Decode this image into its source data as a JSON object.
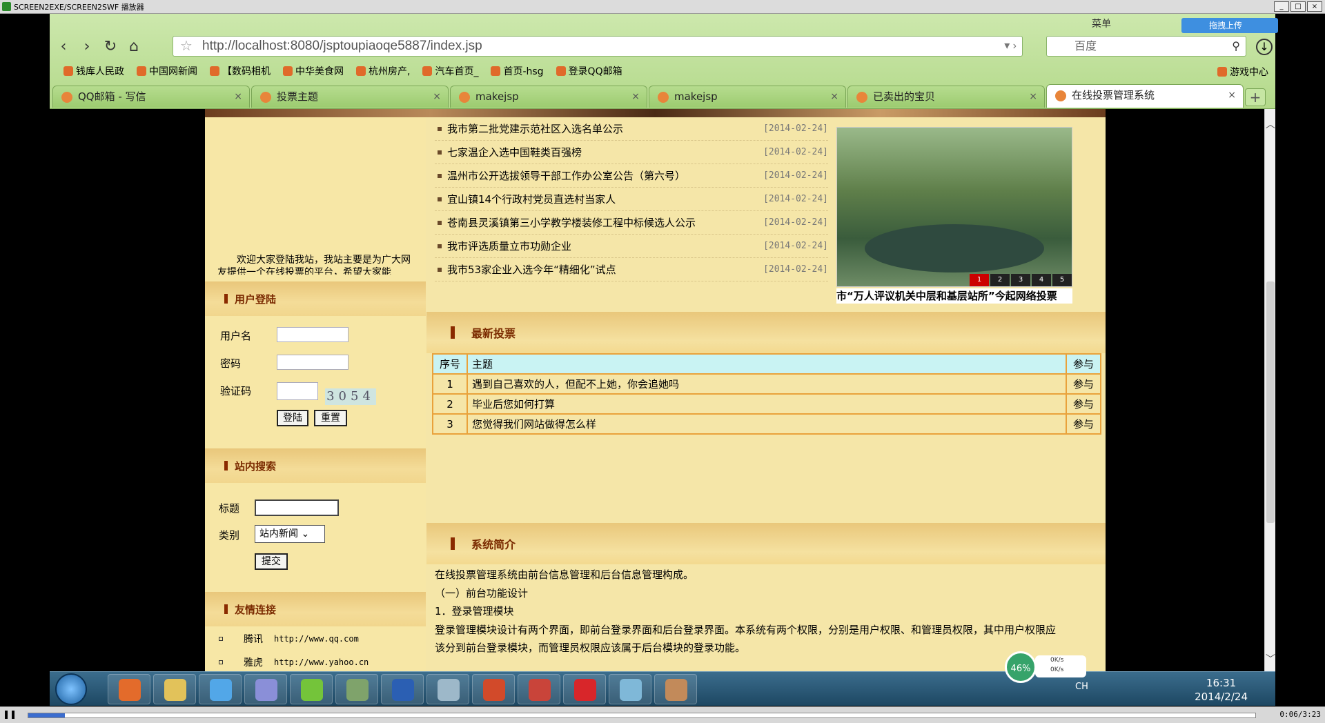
{
  "player": {
    "title": "SCREEN2EXE/SCREEN2SWF 播放器",
    "time": "0:06/3:23",
    "progress_fraction": 0.03
  },
  "browser": {
    "url": "http://localhost:8080/jsptoupiaoqe5887/index.jsp",
    "search_placeholder": "百度",
    "menu_label": "菜单",
    "upload_label": "拖拽上传",
    "bookmarks": [
      "钱库人民政",
      "中国网新闻",
      "【数码相机",
      "中华美食网",
      "杭州房产,",
      "汽车首页_",
      "首页-hsg",
      "登录QQ邮箱"
    ],
    "game_center": "游戏中心",
    "tabs": [
      {
        "label": "QQ邮箱 - 写信"
      },
      {
        "label": "投票主题"
      },
      {
        "label": "makejsp"
      },
      {
        "label": "makejsp"
      },
      {
        "label": "已卖出的宝贝"
      },
      {
        "label": "在线投票管理系统"
      }
    ],
    "new_tab": "+"
  },
  "page": {
    "welcome": "欢迎大家登陆我站，我站主要是为广大网友提供一个在线投票的平台，希望大家能",
    "login": {
      "title": "用户登陆",
      "username_label": "用户名",
      "password_label": "密码",
      "captcha_label": "验证码",
      "captcha_text": "3054",
      "login_button": "登陆",
      "reset_button": "重置"
    },
    "search": {
      "title": "站内搜索",
      "title_label": "标题",
      "type_label": "类别",
      "type_value": "站内新闻",
      "submit_button": "提交"
    },
    "links": {
      "title": "友情连接",
      "items": [
        {
          "name": "腾讯",
          "url": "http://www.qq.com"
        },
        {
          "name": "雅虎",
          "url": "http://www.yahoo.cn"
        }
      ]
    },
    "news": [
      {
        "title": "我市第二批党建示范社区入选名单公示",
        "date": "[2014-02-24]"
      },
      {
        "title": "七家温企入选中国鞋类百强榜",
        "date": "[2014-02-24]"
      },
      {
        "title": "温州市公开选拔领导干部工作办公室公告（第六号）",
        "date": "[2014-02-24]"
      },
      {
        "title": "宜山镇14个行政村党员直选村当家人",
        "date": "[2014-02-24]"
      },
      {
        "title": "苍南县灵溪镇第三小学教学楼装修工程中标候选人公示",
        "date": "[2014-02-24]"
      },
      {
        "title": "我市评选质量立市功勋企业",
        "date": "[2014-02-24]"
      },
      {
        "title": "我市53家企业入选今年“精细化”试点",
        "date": "[2014-02-24]"
      }
    ],
    "slider": {
      "caption": "市“万人评议机关中层和基层站所”今起网络投票",
      "pages": [
        "1",
        "2",
        "3",
        "4",
        "5"
      ]
    },
    "votes": {
      "title": "最新投票",
      "headers": {
        "no": "序号",
        "subject": "主题",
        "action": "参与"
      },
      "rows": [
        {
          "no": "1",
          "subject": "遇到自己喜欢的人，但配不上她，你会追她吗",
          "action": "参与"
        },
        {
          "no": "2",
          "subject": "毕业后您如何打算",
          "action": "参与"
        },
        {
          "no": "3",
          "subject": "您觉得我们网站做得怎么样",
          "action": "参与"
        }
      ]
    },
    "intro": {
      "title": "系统简介",
      "lines": [
        "在线投票管理系统由前台信息管理和后台信息管理构成。",
        "（一）前台功能设计",
        "1．登录管理模块",
        "登录管理模块设计有两个界面，即前台登录界面和后台登录界面。本系统有两个权限，分别是用户权限、和管理员权限，其中用户权限应",
        "该分到前台登录模块，而管理员权限应该属于后台模块的登录功能。"
      ]
    }
  },
  "taskbar": {
    "lang": "CH",
    "time": "16:31",
    "date": "2014/2/24",
    "net_percent": "46%",
    "up_speed": "0K/s",
    "down_speed": "0K/s"
  }
}
